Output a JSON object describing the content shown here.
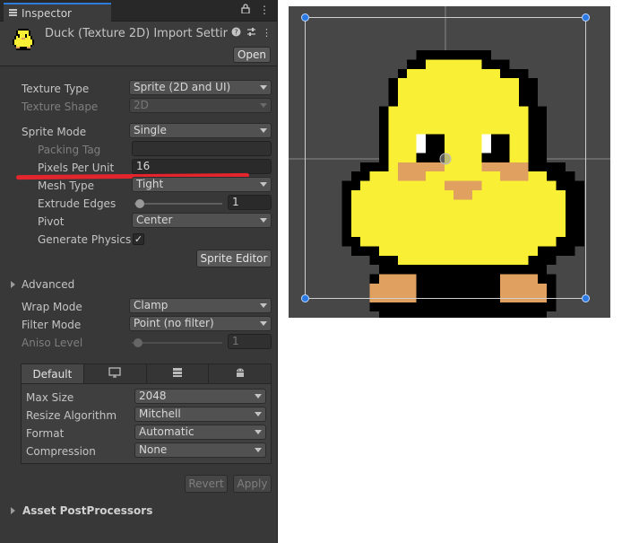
{
  "tab": {
    "title": "Inspector"
  },
  "header": {
    "title": "Duck (Texture 2D) Import Settir",
    "open_label": "Open",
    "icons": [
      "help-icon",
      "preset-icon",
      "more-icon"
    ]
  },
  "texture_type": {
    "label": "Texture Type",
    "value": "Sprite (2D and UI)"
  },
  "texture_shape": {
    "label": "Texture Shape",
    "value": "2D"
  },
  "sprite_mode": {
    "label": "Sprite Mode",
    "value": "Single"
  },
  "packing_tag": {
    "label": "Packing Tag",
    "value": ""
  },
  "pixels_per_unit": {
    "label": "Pixels Per Unit",
    "value": "16"
  },
  "mesh_type": {
    "label": "Mesh Type",
    "value": "Tight"
  },
  "extrude_edges": {
    "label": "Extrude Edges",
    "value": "1"
  },
  "pivot": {
    "label": "Pivot",
    "value": "Center"
  },
  "generate_physics": {
    "label": "Generate Physics",
    "checked": "✓"
  },
  "sprite_editor": {
    "label": "Sprite Editor"
  },
  "advanced": {
    "label": "Advanced"
  },
  "wrap_mode": {
    "label": "Wrap Mode",
    "value": "Clamp"
  },
  "filter_mode": {
    "label": "Filter Mode",
    "value": "Point (no filter)"
  },
  "aniso_level": {
    "label": "Aniso Level",
    "value": "1"
  },
  "platform": {
    "tabs": [
      {
        "label": "Default",
        "icon": ""
      },
      {
        "label": "",
        "icon": "monitor-icon"
      },
      {
        "label": "",
        "icon": "server-icon"
      },
      {
        "label": "",
        "icon": "android-icon"
      }
    ],
    "max_size": {
      "label": "Max Size",
      "value": "2048"
    },
    "resize_algorithm": {
      "label": "Resize Algorithm",
      "value": "Mitchell"
    },
    "format": {
      "label": "Format",
      "value": "Automatic"
    },
    "compression": {
      "label": "Compression",
      "value": "None"
    }
  },
  "actions": {
    "revert": "Revert",
    "apply": "Apply"
  },
  "asset_postprocessors": {
    "label": "Asset PostProcessors"
  },
  "colors": {
    "duck_yellow": "#f9f035",
    "duck_outline": "#000000",
    "duck_feet": "#e0a060",
    "scene_bg": "#474747",
    "handle": "#2b7ae4",
    "annotation": "#e3262d"
  }
}
